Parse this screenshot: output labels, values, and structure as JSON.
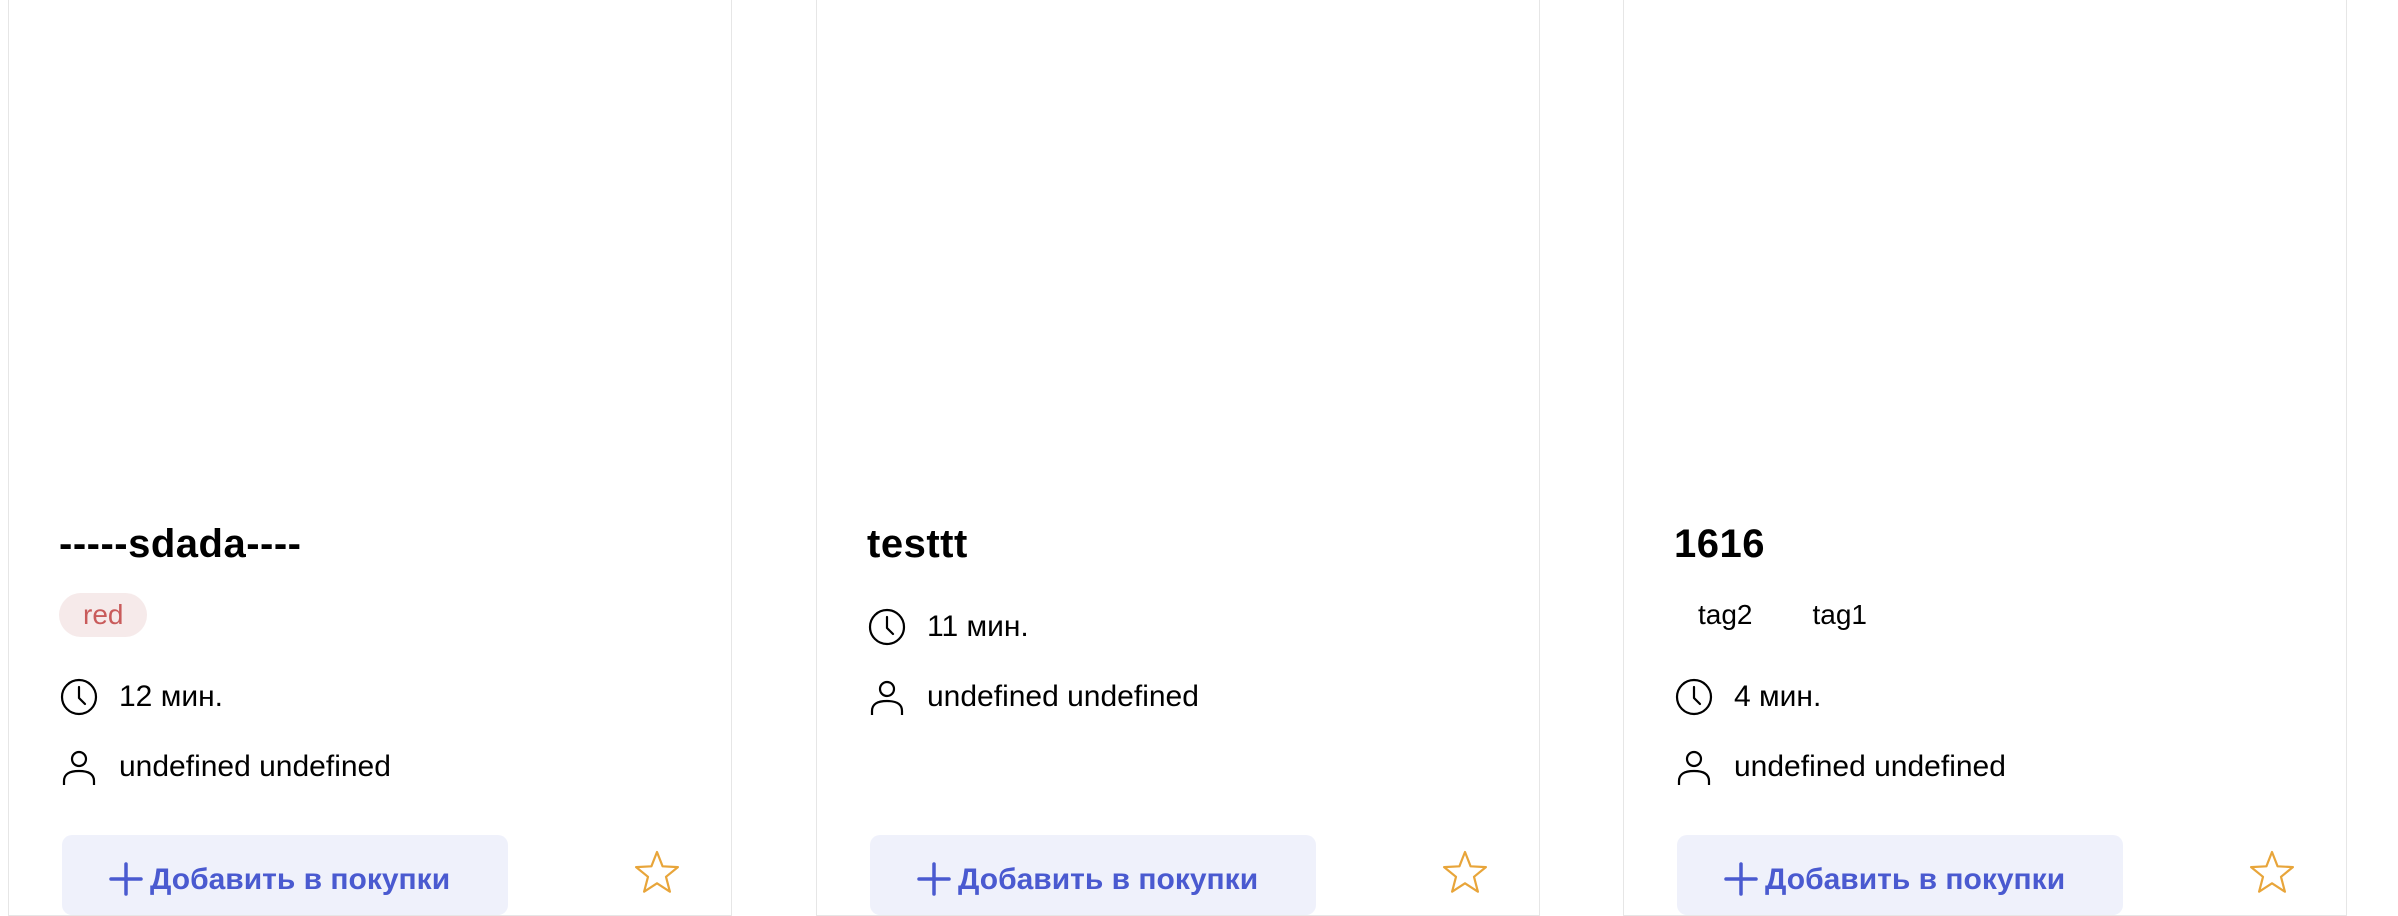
{
  "cards": [
    {
      "title": "-----sdada----",
      "tags": [
        "red"
      ],
      "time": "12 мин.",
      "author": "undefined undefined",
      "add_label": "Добавить в покупки"
    },
    {
      "title": "testtt",
      "tags": [],
      "time": "11 мин.",
      "author": "undefined undefined",
      "add_label": "Добавить в покупки"
    },
    {
      "title": "1616",
      "tags": [
        "tag2",
        "tag1"
      ],
      "time": "4 мин.",
      "author": "undefined undefined",
      "add_label": "Добавить в покупки"
    }
  ],
  "icons": {
    "time": "clock-icon",
    "author": "user-icon",
    "add": "plus-icon",
    "favorite": "star-icon"
  },
  "colors": {
    "accent": "#4a5ad0",
    "button_bg": "#eff1fb",
    "tag_red_bg": "#f6eaea",
    "tag_red_text": "#c95b5b",
    "star": "#e8a53a",
    "card_border": "#e6e6e6"
  }
}
